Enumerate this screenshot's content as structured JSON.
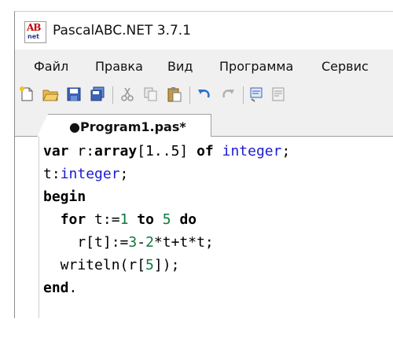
{
  "window": {
    "title": "PascalABC.NET 3.7.1"
  },
  "app_icon": {
    "top_text": "AB",
    "bottom_text": "net"
  },
  "menu": [
    "Файл",
    "Правка",
    "Вид",
    "Программа",
    "Сервис"
  ],
  "toolbar": [
    "new-file-icon",
    "open-folder-icon",
    "save-icon",
    "save-all-icon",
    "cut-icon",
    "copy-icon",
    "paste-icon",
    "undo-icon",
    "redo-icon",
    "compile-icon",
    "format-icon"
  ],
  "tab": {
    "label": "●Program1.pas*"
  },
  "code": [
    [
      {
        "t": "var",
        "c": "kw"
      },
      {
        "t": " r:",
        "c": ""
      },
      {
        "t": "array",
        "c": "kw"
      },
      {
        "t": "[1..5] ",
        "c": ""
      },
      {
        "t": "of",
        "c": "kw"
      },
      {
        "t": " ",
        "c": ""
      },
      {
        "t": "integer",
        "c": "ty"
      },
      {
        "t": ";",
        "c": ""
      }
    ],
    [
      {
        "t": "t:",
        "c": ""
      },
      {
        "t": "integer",
        "c": "ty"
      },
      {
        "t": ";",
        "c": ""
      }
    ],
    [
      {
        "t": "begin",
        "c": "kw"
      }
    ],
    [
      {
        "t": "  ",
        "c": ""
      },
      {
        "t": "for",
        "c": "kw"
      },
      {
        "t": " t:=",
        "c": ""
      },
      {
        "t": "1",
        "c": "nm"
      },
      {
        "t": " ",
        "c": ""
      },
      {
        "t": "to",
        "c": "kw"
      },
      {
        "t": " ",
        "c": ""
      },
      {
        "t": "5",
        "c": "nm"
      },
      {
        "t": " ",
        "c": ""
      },
      {
        "t": "do",
        "c": "kw"
      }
    ],
    [
      {
        "t": "    r[t]:=",
        "c": ""
      },
      {
        "t": "3",
        "c": "nm"
      },
      {
        "t": "-",
        "c": ""
      },
      {
        "t": "2",
        "c": "nm"
      },
      {
        "t": "*t+t*t;",
        "c": ""
      }
    ],
    [
      {
        "t": "  writeln(r[",
        "c": ""
      },
      {
        "t": "5",
        "c": "nm"
      },
      {
        "t": "]);",
        "c": ""
      }
    ],
    [
      {
        "t": "end",
        "c": "kw"
      },
      {
        "t": ".",
        "c": ""
      }
    ]
  ],
  "colors": {
    "keyword": "#000000",
    "type": "#1b1bd1",
    "number": "#0b7a3a"
  }
}
